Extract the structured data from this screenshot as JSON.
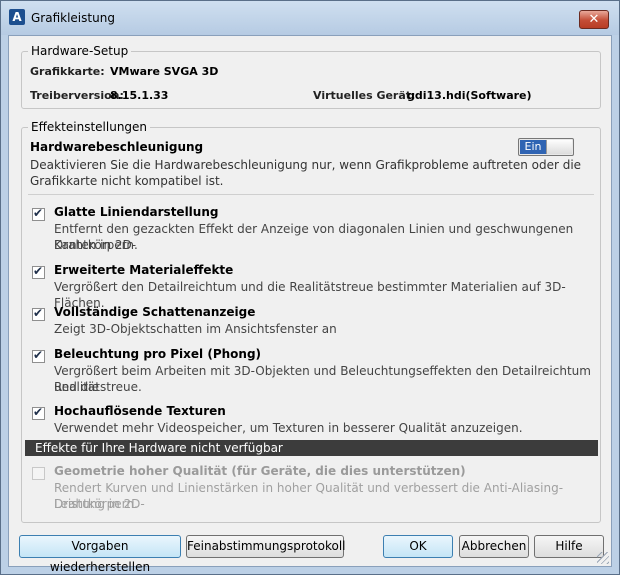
{
  "window": {
    "title": "Grafikleistung",
    "close_label": "✕"
  },
  "hardware": {
    "legend": "Hardware-Setup",
    "card_label": "Grafikkarte:",
    "card_value": "VMware SVGA 3D",
    "driver_label": "Treiberversion:",
    "driver_value": "8.15.1.33",
    "device_label": "Virtuelles Gerät:",
    "device_value": "gdi13.hdi(Software)"
  },
  "effects": {
    "legend": "Effekteinstellungen",
    "accel_title": "Hardwarebeschleunigung",
    "accel_desc_1": "Deaktivieren Sie die Hardwarebeschleunigung nur, wenn Grafikprobleme auftreten oder die",
    "accel_desc_2": "Grafikkarte nicht kompatibel ist.",
    "toggle_label": "Ein",
    "options": [
      {
        "title": "Glatte Liniendarstellung",
        "desc_1": "Entfernt den gezackten Effekt der Anzeige von diagonalen Linien und geschwungenen Kanten in 2D-",
        "desc_2": "Drahtkörpern.",
        "checked": true
      },
      {
        "title": "Erweiterte Materialeffekte",
        "desc_1": "Vergrößert den Detailreichtum und die Realitätstreue bestimmter Materialien auf 3D-Flächen.",
        "desc_2": "",
        "checked": true
      },
      {
        "title": "Vollständige Schattenanzeige",
        "desc_1": "Zeigt 3D-Objektschatten im Ansichtsfenster an",
        "desc_2": "",
        "checked": true
      },
      {
        "title": "Beleuchtung pro Pixel (Phong)",
        "desc_1": "Vergrößert beim Arbeiten mit 3D-Objekten und Beleuchtungseffekten den Detailreichtum und die",
        "desc_2": "Realitätstreue.",
        "checked": true
      },
      {
        "title": "Hochauflösende Texturen",
        "desc_1": "Verwendet mehr Videospeicher, um Texturen in besserer Qualität anzuzeigen.",
        "desc_2": "",
        "checked": true
      }
    ],
    "unavailable_header": "Effekte für Ihre Hardware nicht verfügbar",
    "unavailable": {
      "title": "Geometrie hoher Qualität (für Geräte, die dies unterstützen)",
      "desc_1": "Rendert Kurven und Linienstärken in hoher Qualität und verbessert die Anti-Aliasing-Leistung in 2D-",
      "desc_2": "Drahtkörpern.",
      "checked": false
    }
  },
  "buttons": {
    "restore": "Vorgaben wiederherstellen",
    "log": "Feinabstimmungsprotokoll",
    "ok": "OK",
    "cancel": "Abbrechen",
    "help": "Hilfe"
  }
}
